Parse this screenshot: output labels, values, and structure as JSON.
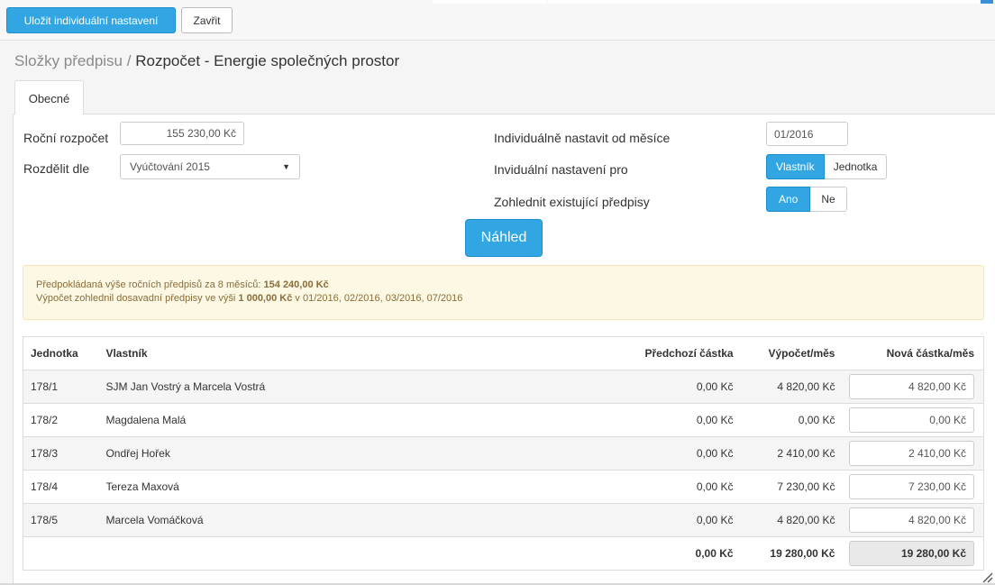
{
  "toolbar": {
    "save_label": "Uložit individuální nastavení",
    "close_label": "Zavřit"
  },
  "breadcrumb": {
    "parent": "Složky předpisu",
    "separator": "/",
    "current": "Rozpočet - Energie společných prostor"
  },
  "tabs": [
    {
      "label": "Obecné",
      "active": true
    }
  ],
  "form": {
    "annual_budget_label": "Roční rozpočet",
    "annual_budget_value": "155 230,00 Kč",
    "split_by_label": "Rozdělit dle",
    "split_by_value": "Vyúčtování 2015",
    "individual_from_label": "Individuálně nastavit od měsíce",
    "individual_from_value": "01/2016",
    "individual_for_label": "Inviduální nastavení pro",
    "individual_for_options": [
      "Vlastník",
      "Jednotka"
    ],
    "individual_for_selected": "Vlastník",
    "consider_existing_label": "Zohlednit existující předpisy",
    "consider_existing_options": [
      "Ano",
      "Ne"
    ],
    "consider_existing_selected": "Ano",
    "preview_label": "Náhled"
  },
  "alert": {
    "line1_prefix": "Předpokládaná výše ročních předpisů za 8 měsíců: ",
    "line1_bold": "154 240,00 Kč",
    "line2_prefix": "Výpočet zohlednil dosavadní předpisy ve výši ",
    "line2_bold": "1 000,00 Kč",
    "line2_suffix": " v 01/2016, 02/2016, 03/2016, 07/2016"
  },
  "table": {
    "headers": [
      "Jednotka",
      "Vlastník",
      "Předchozí částka",
      "Výpočet/měs",
      "Nová částka/měs"
    ],
    "rows": [
      {
        "unit": "178/1",
        "owner": "SJM Jan Vostrý a Marcela Vostrá",
        "previous": "0,00 Kč",
        "calc": "4 820,00 Kč",
        "new": "4 820,00 Kč"
      },
      {
        "unit": "178/2",
        "owner": "Magdalena Malá",
        "previous": "0,00 Kč",
        "calc": "0,00 Kč",
        "new": "0,00 Kč"
      },
      {
        "unit": "178/3",
        "owner": "Ondřej Hořek",
        "previous": "0,00 Kč",
        "calc": "2 410,00 Kč",
        "new": "2 410,00 Kč"
      },
      {
        "unit": "178/4",
        "owner": "Tereza Maxová",
        "previous": "0,00 Kč",
        "calc": "7 230,00 Kč",
        "new": "7 230,00 Kč"
      },
      {
        "unit": "178/5",
        "owner": "Marcela Vomáčková",
        "previous": "0,00 Kč",
        "calc": "4 820,00 Kč",
        "new": "4 820,00 Kč"
      }
    ],
    "totals": {
      "previous": "0,00 Kč",
      "calc": "19 280,00 Kč",
      "new": "19 280,00 Kč"
    }
  },
  "colors": {
    "accent": "#32a6e3",
    "alert_bg": "#fcf8e3",
    "alert_text": "#8a6d3b"
  }
}
